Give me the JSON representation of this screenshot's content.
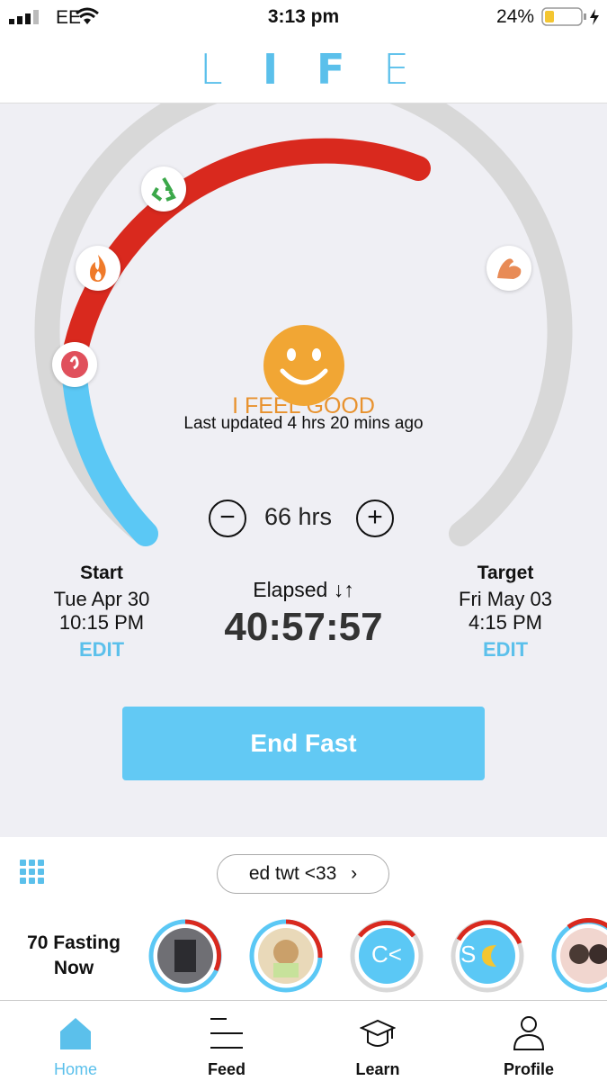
{
  "status_bar": {
    "carrier": "EE",
    "time": "3:13 pm",
    "battery_percent": "24%"
  },
  "header": {
    "logo_letters": [
      "L",
      "I",
      "F",
      "E"
    ]
  },
  "progress": {
    "fraction_complete": 0.62,
    "colors": {
      "done": "#d9291e",
      "start": "#5bc8f5",
      "remaining": "#d8d8d8"
    }
  },
  "mood": {
    "label": "I FEEL GOOD",
    "last_updated": "Last updated 4 hrs 20 mins ago"
  },
  "goal": {
    "value": "66 hrs",
    "minus_symbol": "−",
    "plus_symbol": "+"
  },
  "start": {
    "heading": "Start",
    "date": "Tue Apr 30",
    "time": "10:15 PM",
    "edit_label": "EDIT"
  },
  "elapsed": {
    "label": "Elapsed ↓↑",
    "value": "40:57:57"
  },
  "target": {
    "heading": "Target",
    "date": "Fri May 03",
    "time": "4:15 PM",
    "edit_label": "EDIT"
  },
  "end_fast_label": "End Fast",
  "circle": {
    "pill_label": "ed twt <33",
    "fasting_now": [
      "70 Fasting",
      "Now"
    ],
    "avatars": [
      {
        "text": "",
        "icon": "photo-avatar"
      },
      {
        "text": "",
        "icon": "photo-avatar"
      },
      {
        "text": "C<",
        "icon": "initials-avatar"
      },
      {
        "text": "S",
        "icon": "moon-avatar"
      },
      {
        "text": "",
        "icon": "photo-avatar"
      }
    ]
  },
  "tabs": [
    {
      "label": "Home",
      "icon": "home-icon",
      "active": true
    },
    {
      "label": "Feed",
      "icon": "feed-icon",
      "active": false
    },
    {
      "label": "Learn",
      "icon": "graduation-cap-icon",
      "active": false
    },
    {
      "label": "Profile",
      "icon": "person-icon",
      "active": false
    }
  ]
}
